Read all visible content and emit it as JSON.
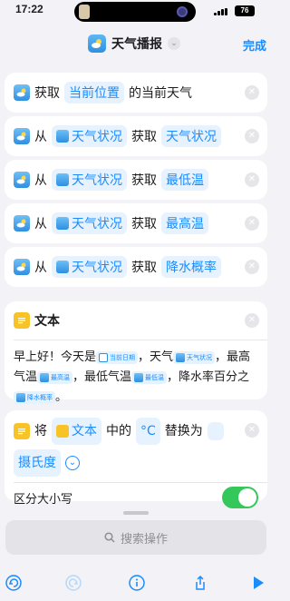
{
  "status": {
    "time": "17:22",
    "battery": "76"
  },
  "nav": {
    "title": "天气播报",
    "done": "完成"
  },
  "actions": [
    {
      "a": "获取",
      "token": "当前位置",
      "b": "的当前天气"
    },
    {
      "a": "从",
      "token1": "天气状况",
      "b": "获取",
      "token2": "天气状况"
    },
    {
      "a": "从",
      "token1": "天气状况",
      "b": "获取",
      "token2": "最低温"
    },
    {
      "a": "从",
      "token1": "天气状况",
      "b": "获取",
      "token2": "最高温"
    },
    {
      "a": "从",
      "token1": "天气状况",
      "b": "获取",
      "token2": "降水概率"
    }
  ],
  "text_action": {
    "title": "文本",
    "p1": "早上好！今天是",
    "t_date": "当前日期",
    "p2": "，天气",
    "t_weather": "天气状况",
    "p3": "，最高气温",
    "t_high": "最高温",
    "p4": "，最低气温",
    "t_low": "最低温",
    "p5": "，降水率百分之",
    "t_rain": "降水概率",
    "p6": "。"
  },
  "replace_action": {
    "w1": "将",
    "token_text": "文本",
    "w2": "中的",
    "token_find": "°C",
    "w3": "替换为",
    "token_replace": "摄氏度",
    "case_label": "区分大小写",
    "case_on": true
  },
  "search": {
    "placeholder": "搜索操作"
  },
  "colors": {
    "accent": "#1a8cff",
    "toggle": "#34c759",
    "text_icon": "#f7c325"
  },
  "icons": [
    "undo-icon",
    "redo-icon",
    "info-icon",
    "share-icon",
    "play-icon"
  ]
}
